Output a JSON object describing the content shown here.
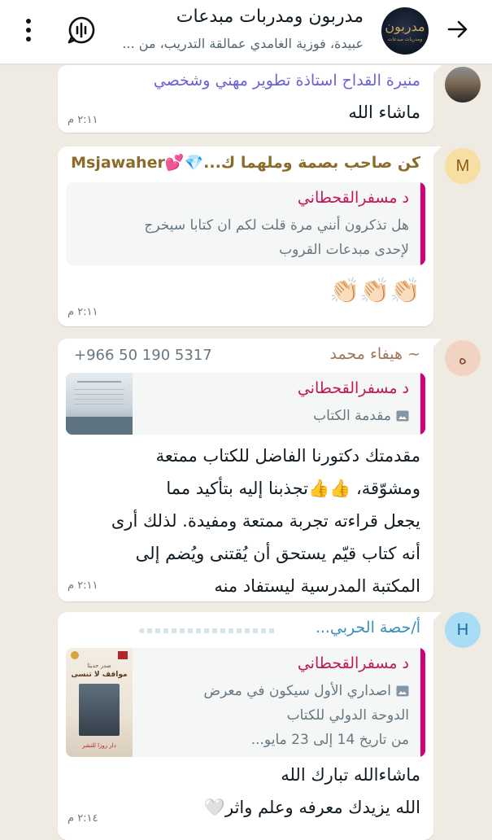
{
  "header": {
    "title": "مدربون ومدربات مبدعات",
    "subtitle": "عبيدة، فوزية الغامدي عمالقة التدريب، من ...",
    "avatar_text": "مدربون",
    "avatar_subtext": "ومدربات مبدعات"
  },
  "messages": [
    {
      "sender": "منيرة القداح استاذة تطوير مهني وشخصي",
      "text": "ماشاء الله",
      "time": "٢:١١ م"
    },
    {
      "avatar": "M",
      "sender": "كن صاحب بصمة وملهما ك...💎💕Msjawaher",
      "quote_name": "د مسفرالقحطاني",
      "quote_lines": [
        "هل تذكرون أنني مرة قلت لكم  ان كتابا سيخرج",
        "لإحدى مبدعات القروب"
      ],
      "text": "👏🏻👏🏻👏🏻",
      "time": "٢:١١ م"
    },
    {
      "avatar": "ه",
      "sender": "~ هيفاء محمد",
      "phone": "+966 50 190 5317",
      "quote_name": "د مسفرالقحطاني",
      "quote_lines": [
        "مقدمة الكتاب"
      ],
      "lines": [
        "مقدمتك دكتورنا الفاضل  للكتاب ممتعة",
        "ومشوّقة، 👍👍تجذبنا إليه بتأكيد مما",
        "يجعل قراءته تجربة ممتعة ومفيدة. لذلك أرى",
        "أنه كتاب قيّم يستحق أن يُقتنى ويُضم إلى",
        "المكتبة المدرسية ليستفاد منه"
      ],
      "time": "٢:١١ م"
    },
    {
      "avatar": "H",
      "sender": "أ/حصة الحربي...",
      "quote_name": "د مسفرالقحطاني",
      "quote_lines": [
        "اصداري الأول سيكون في معرض",
        "الدوحة الدولي للكتاب",
        "من تاريخ 14 إلى 23 مايو..."
      ],
      "thumb_lines": [
        "صدر حديثا",
        "مواقف لا تنسى",
        "دار روزا للنشر"
      ],
      "lines": [
        "ماشاءالله تبارك الله",
        "الله يزيدك معرفه وعلم واثر🤍"
      ],
      "time": "٢:١٤ م"
    }
  ],
  "icons": {
    "back": "arrow-right-icon",
    "call": "voice-chat-icon",
    "menu": "more-vertical-icon",
    "image": "image-icon"
  }
}
